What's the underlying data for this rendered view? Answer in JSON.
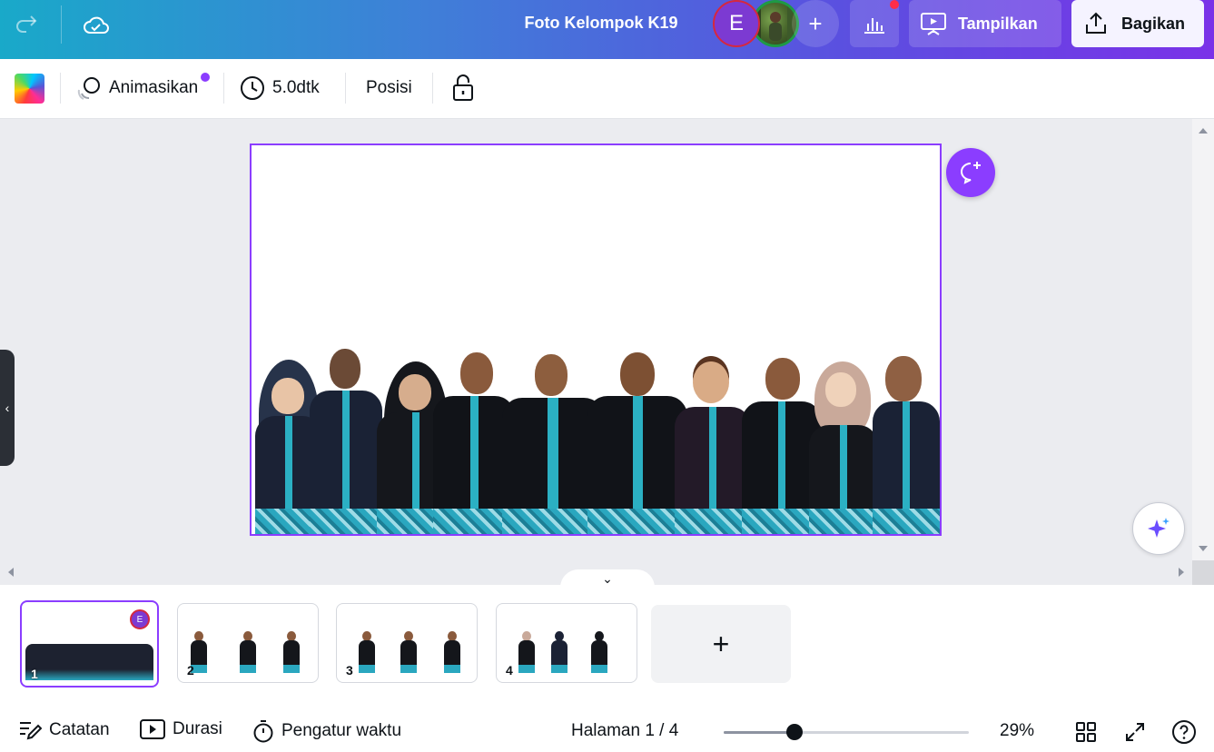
{
  "header": {
    "title": "Foto Kelompok K19",
    "avatar_initial": "E",
    "present_label": "Tampilkan",
    "share_label": "Bagikan"
  },
  "toolbar": {
    "animate_label": "Animasikan",
    "duration_label": "5.0dtk",
    "position_label": "Posisi"
  },
  "thumbnails": [
    {
      "number": "1",
      "badge": "E",
      "active": true
    },
    {
      "number": "2"
    },
    {
      "number": "3"
    },
    {
      "number": "4"
    }
  ],
  "footer": {
    "notes_label": "Catatan",
    "duration_label": "Durasi",
    "timer_label": "Pengatur waktu",
    "page_indicator": "Halaman 1 / 4",
    "zoom_value": "29%",
    "zoom_fraction": 0.29
  },
  "colors": {
    "accent": "#8b3dff",
    "brand_gradient_start": "#19a9c9",
    "brand_gradient_end": "#7a32e8"
  },
  "icons": [
    "redo-icon",
    "cloud-saved-icon",
    "plus-icon",
    "bar-chart-icon",
    "present-screen-icon",
    "share-upload-icon",
    "animate-icon",
    "clock-icon",
    "lock-icon",
    "chevron-left-icon",
    "comment-add-icon",
    "magic-sparkle-icon",
    "chevron-down-icon",
    "notes-icon",
    "play-icon",
    "timer-icon",
    "grid-icon",
    "fullscreen-icon",
    "help-icon"
  ]
}
